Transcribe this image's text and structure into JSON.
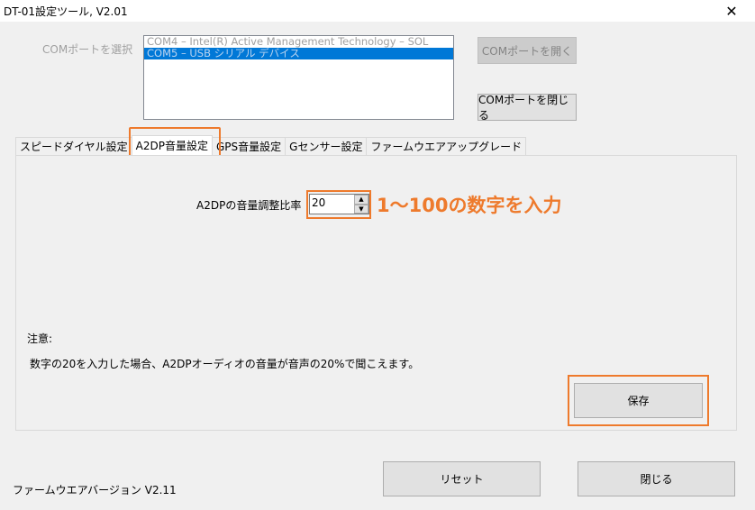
{
  "window": {
    "title": "DT-01設定ツール, V2.01",
    "close_glyph": "✕"
  },
  "com_port": {
    "label": "COMポートを選択",
    "items": [
      {
        "label": "COM4  –  Intel(R) Active Management Technology – SOL",
        "selected": false
      },
      {
        "label": "COM5  –  USB シリアル デバイス",
        "selected": true
      }
    ],
    "open_label": "COMポートを開く",
    "close_label": "COMポートを閉じる"
  },
  "tabs": [
    {
      "label": "スピードダイヤル設定",
      "active": false
    },
    {
      "label": "A2DP音量設定",
      "active": true
    },
    {
      "label": "GPS音量設定",
      "active": false
    },
    {
      "label": "Gセンサー設定",
      "active": false
    },
    {
      "label": "ファームウエアアップグレード",
      "active": false
    }
  ],
  "a2dp": {
    "ratio_label": "A2DPの音量調整比率",
    "ratio_value": "20",
    "annotation": "1〜100の数字を入力",
    "note_title": "注意:",
    "note_text": "数字の20を入力した場合、A2DPオーディオの音量が音声の20%で聞こえます。",
    "save_label": "保存"
  },
  "footer": {
    "firmware_version": "ファームウエアバージョン V2.11",
    "reset_label": "リセット",
    "exit_label": "閉じる"
  },
  "colors": {
    "highlight": "#ee7a2c",
    "selection": "#0078d7"
  }
}
